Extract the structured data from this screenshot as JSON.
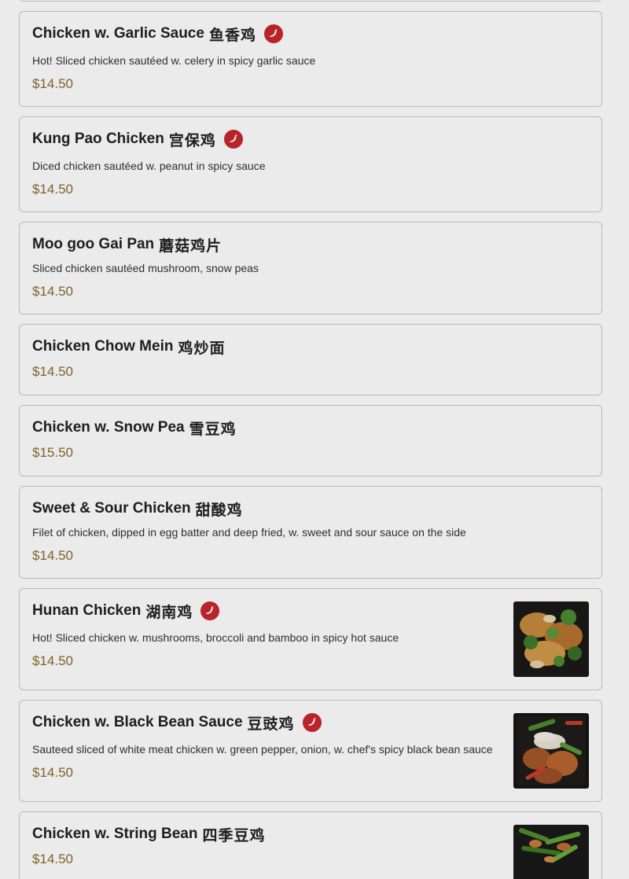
{
  "menu": {
    "items": [
      {
        "name": "Chicken w. Garlic Sauce",
        "chinese": "鱼香鸡",
        "spicy": true,
        "desc": "Hot! Sliced chicken sautéed w. celery in spicy garlic sauce",
        "price": "$14.50",
        "image": false
      },
      {
        "name": "Kung Pao Chicken",
        "chinese": "宫保鸡",
        "spicy": true,
        "desc": "Diced chicken sautéed w. peanut in spicy sauce",
        "price": "$14.50",
        "image": false
      },
      {
        "name": "Moo goo Gai Pan",
        "chinese": "蘑菇鸡片",
        "spicy": false,
        "desc": "Sliced chicken sautéed mushroom, snow peas",
        "price": "$14.50",
        "image": false
      },
      {
        "name": "Chicken Chow Mein",
        "chinese": "鸡炒面",
        "spicy": false,
        "desc": "",
        "price": "$14.50",
        "image": false
      },
      {
        "name": "Chicken w. Snow Pea",
        "chinese": "雪豆鸡",
        "spicy": false,
        "desc": "",
        "price": "$15.50",
        "image": false
      },
      {
        "name": "Sweet & Sour Chicken",
        "chinese": "甜酸鸡",
        "spicy": false,
        "desc": "Filet of chicken, dipped in egg batter and deep fried, w. sweet and sour sauce on the side",
        "price": "$14.50",
        "image": false
      },
      {
        "name": "Hunan Chicken",
        "chinese": "湖南鸡",
        "spicy": true,
        "desc": "Hot! Sliced chicken w. mushrooms, broccoli and bamboo in spicy hot sauce",
        "price": "$14.50",
        "image": true
      },
      {
        "name": "Chicken w. Black Bean Sauce",
        "chinese": "豆豉鸡",
        "spicy": true,
        "desc": "Sauteed sliced of white meat chicken w. green pepper, onion, w. chef's spicy black bean sauce",
        "price": "$14.50",
        "image": true
      },
      {
        "name": "Chicken w. String Bean",
        "chinese": "四季豆鸡",
        "spicy": false,
        "desc": "",
        "price": "$14.50",
        "image": true
      }
    ]
  },
  "colors": {
    "price": "#8a6b2c",
    "spicy_badge": "#c8282d",
    "border": "#c9c9c9"
  },
  "icons": {
    "spicy": "chili-pepper-icon"
  }
}
